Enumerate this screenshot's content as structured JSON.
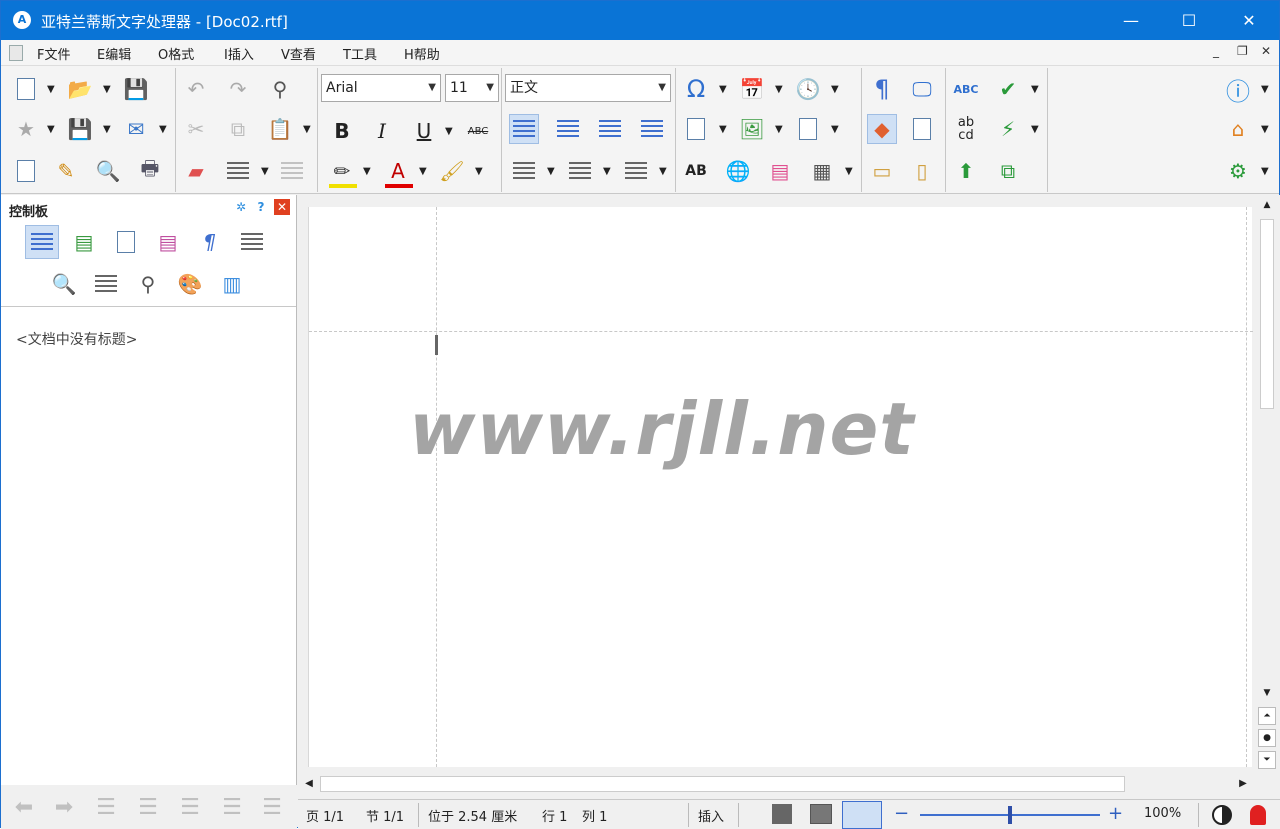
{
  "window": {
    "title": "亚特兰蒂斯文字处理器 - [Doc02.rtf]",
    "app_icon": "A",
    "minimize": "—",
    "maximize": "☐",
    "close": "✕"
  },
  "menu": {
    "items": [
      "F文件",
      "E编辑",
      "O格式",
      "I插入",
      "V查看",
      "T工具",
      "H帮助"
    ],
    "mdi_minimize": "_",
    "mdi_restore": "❐",
    "mdi_close": "✕"
  },
  "toolbar": {
    "font": "Arial",
    "size": "11",
    "style": "正文",
    "bold": "B",
    "italic": "I",
    "underline": "U",
    "strike": "ABC",
    "case": "AB",
    "font_color": "A",
    "omega": "Ω",
    "spell_top": "ABC",
    "spell_mid": "ab",
    "spell_bot": "cd",
    "para": "¶"
  },
  "panel": {
    "title": "控制板",
    "outline_text": "<文档中没有标题>"
  },
  "watermark": "www.rjll.net",
  "status": {
    "page": "页 1/1",
    "section": "节 1/1",
    "position": "位于 2.54 厘米",
    "line": "行 1",
    "column": "列 1",
    "mode": "插入",
    "zoom": "100%",
    "zoom_minus": "−",
    "zoom_plus": "+"
  },
  "colors": {
    "titlebar": "#0a74d6",
    "accent_blue": "#2f6fcf",
    "panel_close": "#e04020"
  }
}
